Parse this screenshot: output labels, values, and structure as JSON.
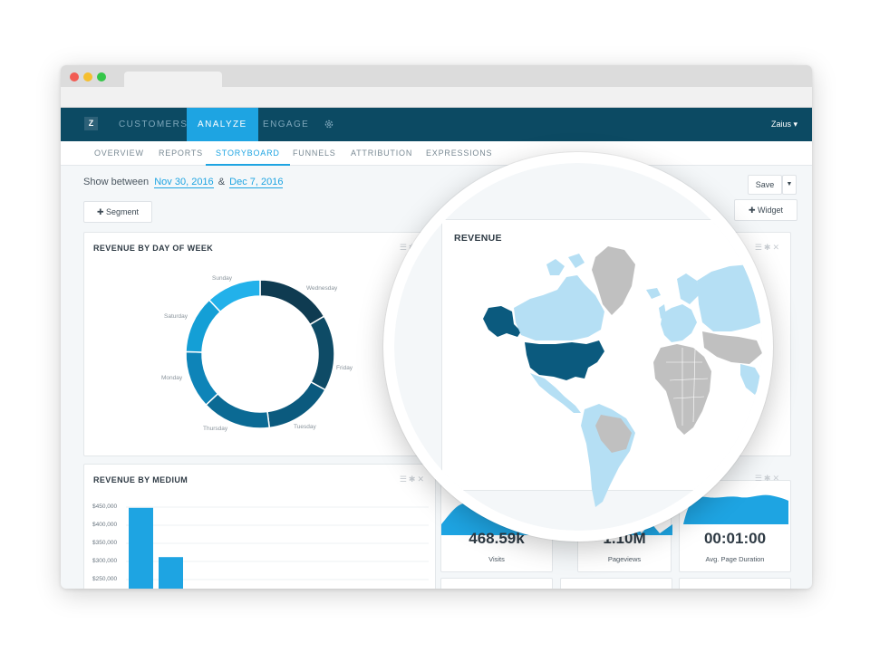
{
  "nav": {
    "logo": "Z",
    "items": [
      {
        "label": "CUSTOMERS"
      },
      {
        "label": "ANALYZE"
      },
      {
        "label": "ENGAGE"
      }
    ],
    "user": "Zaius ▾"
  },
  "subnav": {
    "items": [
      {
        "label": "OVERVIEW"
      },
      {
        "label": "REPORTS"
      },
      {
        "label": "STORYBOARD"
      },
      {
        "label": "FUNNELS"
      },
      {
        "label": "ATTRIBUTION"
      },
      {
        "label": "EXPRESSIONS"
      }
    ]
  },
  "filter": {
    "prefix": "Show between",
    "start_date": "Nov 30, 2016",
    "separator": "&",
    "end_date": "Dec 7, 2016"
  },
  "buttons": {
    "save": "Save",
    "segment": "✚ Segment",
    "widget": "✚ Widget"
  },
  "widgets": {
    "day_of_week": {
      "title": "REVENUE BY DAY OF WEEK",
      "labels": [
        "Sunday",
        "Wednesday",
        "Saturday",
        "Friday",
        "Monday",
        "Thursday",
        "Tuesday"
      ]
    },
    "revenue": {
      "title": "REVENUE"
    },
    "medium": {
      "title": "REVENUE BY MEDIUM",
      "y_ticks": [
        "$450,000",
        "$400,000",
        "$350,000",
        "$300,000",
        "$250,000"
      ]
    },
    "visits": {
      "value": "468.59k",
      "label": "Visits"
    },
    "pageviews": {
      "value": "1.10M",
      "label": "Pageviews"
    },
    "duration": {
      "value": "00:01:00",
      "label": "Avg. Page Duration"
    }
  },
  "chart_data": [
    {
      "type": "pie",
      "title": "REVENUE BY DAY OF WEEK",
      "categories": [
        "Wednesday",
        "Friday",
        "Tuesday",
        "Thursday",
        "Monday",
        "Saturday",
        "Sunday"
      ],
      "values": [
        16.5,
        16.5,
        15,
        15,
        12.5,
        12.5,
        12
      ],
      "colors": [
        "#0f3b51",
        "#0e4b66",
        "#0b5a7e",
        "#0b6a94",
        "#0e84b8",
        "#149fd6",
        "#22b1ea"
      ]
    },
    {
      "type": "bar",
      "title": "REVENUE BY MEDIUM",
      "ylim": [
        200000,
        470000
      ],
      "y_ticks": [
        450000,
        400000,
        350000,
        300000,
        250000
      ],
      "values": [
        448000,
        312000
      ]
    }
  ],
  "colors": {
    "navbar": "#0c4a63",
    "accent": "#1ea4e2",
    "map_highlight": "#0b5a7e",
    "map_light": "#b5dff4",
    "map_grey": "#c0c0c0"
  }
}
